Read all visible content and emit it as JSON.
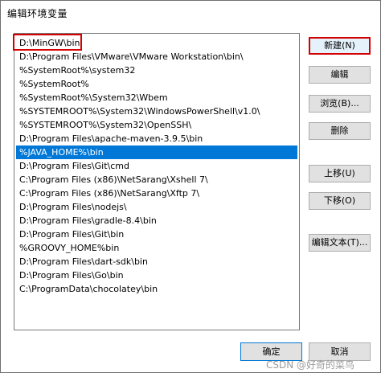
{
  "dialog": {
    "title": "编辑环境变量"
  },
  "paths": [
    {
      "value": "D:\\MinGW\\bin",
      "selected": false
    },
    {
      "value": "D:\\Program Files\\VMware\\VMware Workstation\\bin\\",
      "selected": false
    },
    {
      "value": "%SystemRoot%\\system32",
      "selected": false
    },
    {
      "value": "%SystemRoot%",
      "selected": false
    },
    {
      "value": "%SystemRoot%\\System32\\Wbem",
      "selected": false
    },
    {
      "value": "%SYSTEMROOT%\\System32\\WindowsPowerShell\\v1.0\\",
      "selected": false
    },
    {
      "value": "%SYSTEMROOT%\\System32\\OpenSSH\\",
      "selected": false
    },
    {
      "value": "D:\\Program Files\\apache-maven-3.9.5\\bin",
      "selected": false
    },
    {
      "value": "%JAVA_HOME%\\bin",
      "selected": true
    },
    {
      "value": "D:\\Program Files\\Git\\cmd",
      "selected": false
    },
    {
      "value": "C:\\Program Files (x86)\\NetSarang\\Xshell 7\\",
      "selected": false
    },
    {
      "value": "C:\\Program Files (x86)\\NetSarang\\Xftp 7\\",
      "selected": false
    },
    {
      "value": "D:\\Program Files\\nodejs\\",
      "selected": false
    },
    {
      "value": "D:\\Program Files\\gradle-8.4\\bin",
      "selected": false
    },
    {
      "value": "D:\\Program Files\\Git\\bin",
      "selected": false
    },
    {
      "value": "%GROOVY_HOME%bin",
      "selected": false
    },
    {
      "value": "D:\\Program Files\\dart-sdk\\bin",
      "selected": false
    },
    {
      "value": "D:\\Program Files\\Go\\bin",
      "selected": false
    },
    {
      "value": "C:\\ProgramData\\chocolatey\\bin",
      "selected": false
    }
  ],
  "buttons": {
    "new": "新建(N)",
    "edit": "编辑",
    "browse": "浏览(B)...",
    "delete": "删除",
    "move_up": "上移(U)",
    "move_down": "下移(O)",
    "edit_text": "编辑文本(T)...",
    "ok": "确定",
    "cancel": "取消"
  },
  "watermark": "CSDN @好奇的菜鸟",
  "colors": {
    "selection": "#0078d7",
    "highlight": "#d40000"
  }
}
